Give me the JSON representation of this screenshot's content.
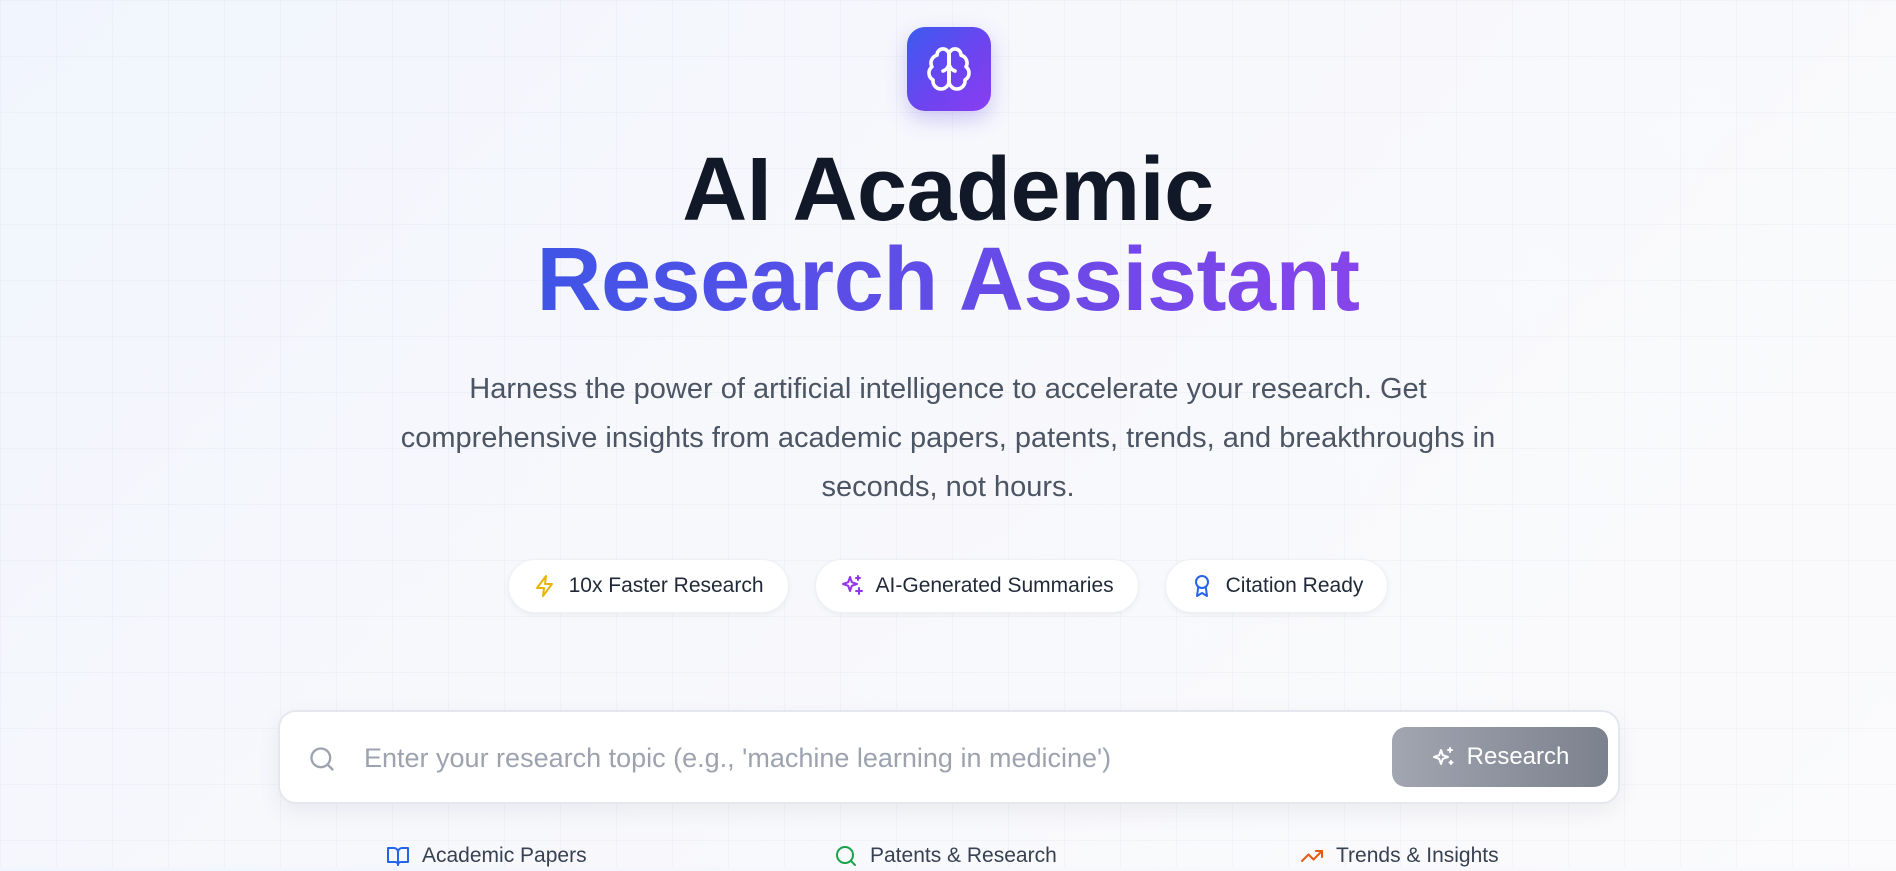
{
  "logo": {
    "icon": "brain-icon",
    "gradient": [
      "#3b5bef",
      "#8b3df2"
    ]
  },
  "hero": {
    "title_line1": "AI Academic",
    "title_line2": "Research Assistant",
    "subtitle": "Harness the power of artificial intelligence to accelerate your research. Get comprehensive insights from academic papers, patents, trends, and breakthroughs in seconds, not hours."
  },
  "features": [
    {
      "label": "10x Faster Research",
      "icon": "lightning-icon",
      "color": "#eab308"
    },
    {
      "label": "AI-Generated Summaries",
      "icon": "sparkles-icon",
      "color": "#9333ea"
    },
    {
      "label": "Citation Ready",
      "icon": "award-icon",
      "color": "#2563eb"
    }
  ],
  "search": {
    "placeholder": "Enter your research topic (e.g., 'machine learning in medicine')",
    "value": "",
    "button_label": "Research"
  },
  "categories": [
    {
      "label": "Academic Papers",
      "icon": "book-icon",
      "color": "#2563eb"
    },
    {
      "label": "Patents & Research",
      "icon": "search-icon",
      "color": "#16a34a"
    },
    {
      "label": "Trends & Insights",
      "icon": "trending-up-icon",
      "color": "#ea580c"
    }
  ]
}
